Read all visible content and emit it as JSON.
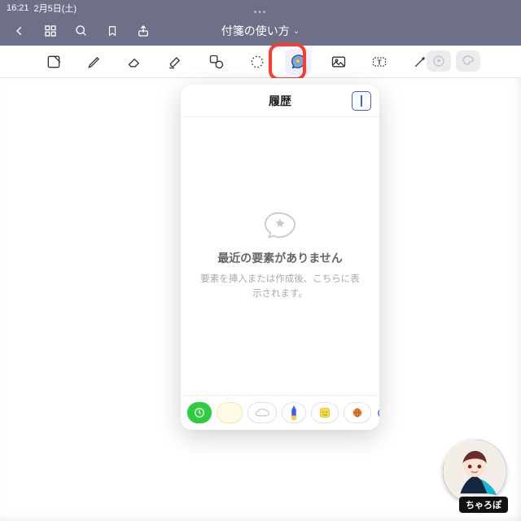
{
  "status": {
    "time": "16:21",
    "date": "2月5日(土)"
  },
  "nav": {
    "title": "付箋の使い方"
  },
  "toolbar": {
    "tools": [
      "select-frame",
      "pen",
      "eraser",
      "highlighter",
      "shape",
      "lasso",
      "sticker",
      "image",
      "text",
      "magic"
    ]
  },
  "popover": {
    "title": "履歴",
    "empty_title": "最近の要素がありません",
    "empty_sub": "要素を挿入または作成後、こちらに表示されます。",
    "footer_items": [
      "clock",
      "note-yellow",
      "cloud",
      "pen-blue",
      "stamp",
      "ball",
      "add"
    ]
  },
  "avatar": {
    "label": "ちゃろぽ"
  },
  "colors": {
    "accent": "#3b5bff",
    "highlight": "#ff3b30",
    "nav": "#6e7089"
  }
}
